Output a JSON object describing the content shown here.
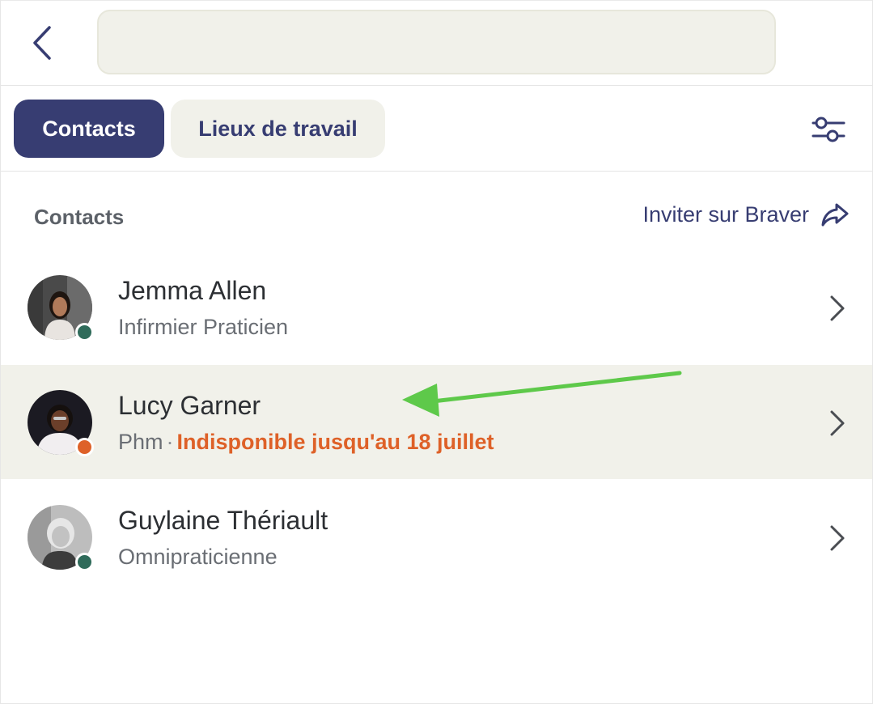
{
  "header": {
    "back_icon": "chevron-left-icon",
    "search": {
      "value": "",
      "placeholder": ""
    }
  },
  "tabs": [
    {
      "label": "Contacts",
      "active": true
    },
    {
      "label": "Lieux de travail",
      "active": false
    }
  ],
  "filter_icon": "sliders-icon",
  "section": {
    "title": "Contacts",
    "invite_label": "Inviter sur Braver",
    "invite_icon": "share-arrow-icon"
  },
  "contacts": [
    {
      "name": "Jemma Allen",
      "role": "Infirmier Praticien",
      "status": "online",
      "status_color": "#2f6b5a"
    },
    {
      "name": "Lucy Garner",
      "role": "Phm",
      "separator": "·",
      "availability": "Indisponible jusqu'au 18 juillet",
      "status": "away",
      "status_color": "#de6128",
      "highlighted": true
    },
    {
      "name": "Guylaine Thériault",
      "role": "Omnipraticienne",
      "status": "online",
      "status_color": "#2f6b5a"
    }
  ],
  "annotation": {
    "type": "arrow",
    "color": "#5ec94a"
  },
  "colors": {
    "primary": "#373d72",
    "surface": "#f1f1ea",
    "warning": "#de6128",
    "online": "#2f6b5a"
  }
}
